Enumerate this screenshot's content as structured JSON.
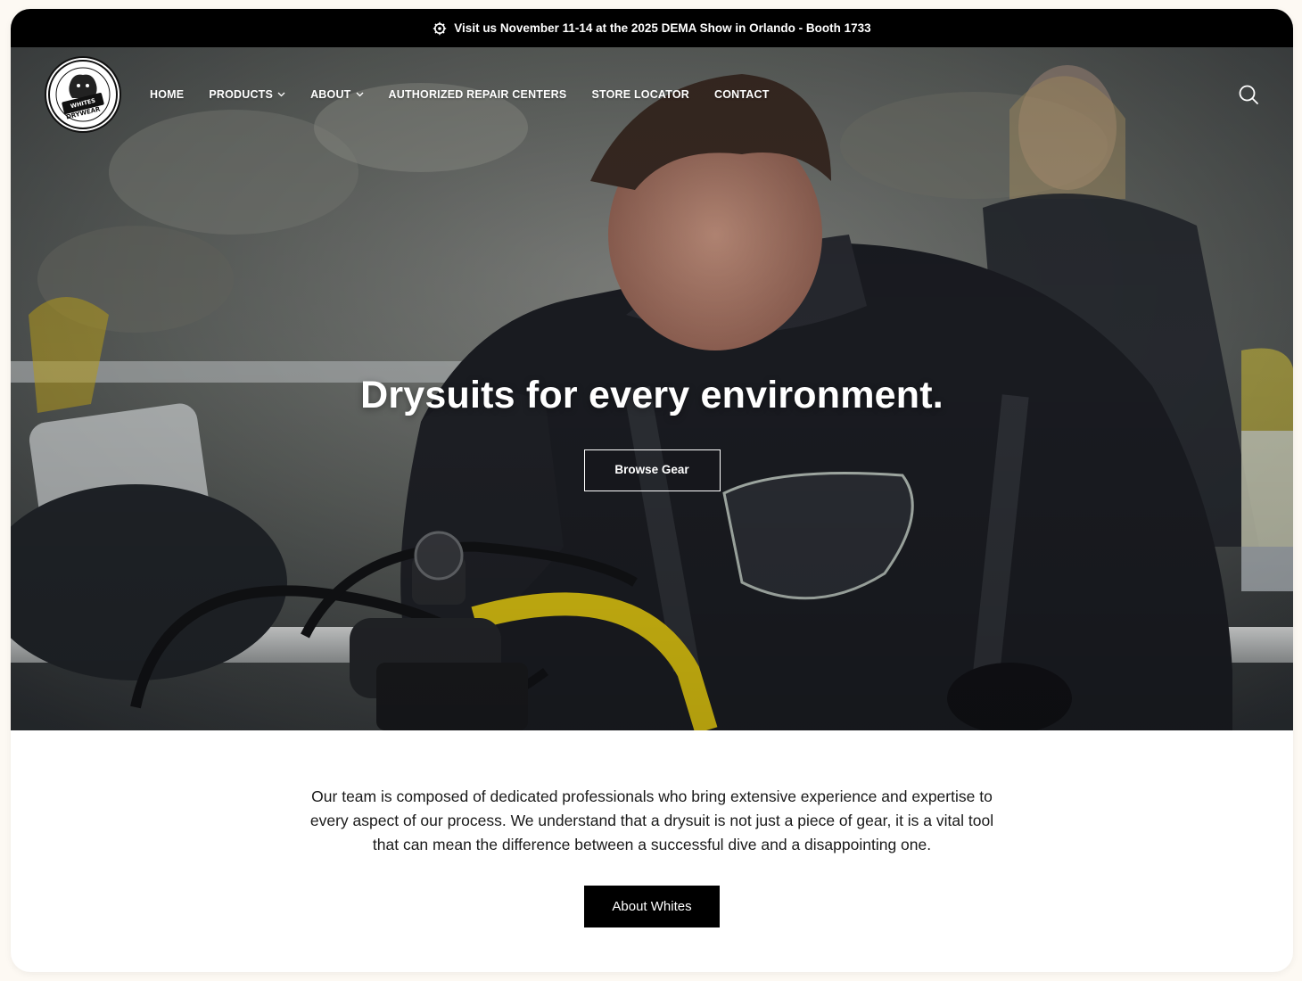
{
  "announcement": {
    "icon": "wheel-icon",
    "text": "Visit us November 11-14 at the 2025 DEMA Show in Orlando - Booth 1733"
  },
  "header": {
    "logo_alt": "Whites Drywear",
    "logo_text_top": "WHITES",
    "logo_text_bottom": "DRYWEAR",
    "nav": [
      {
        "label": "HOME",
        "dropdown": false
      },
      {
        "label": "PRODUCTS",
        "dropdown": true
      },
      {
        "label": "ABOUT",
        "dropdown": true
      },
      {
        "label": "AUTHORIZED REPAIR CENTERS",
        "dropdown": false
      },
      {
        "label": "STORE LOCATOR",
        "dropdown": false
      },
      {
        "label": "CONTACT",
        "dropdown": false
      }
    ],
    "search_icon": "search-icon"
  },
  "hero": {
    "title": "Drysuits for every environment.",
    "button_label": "Browse Gear"
  },
  "about": {
    "text": "Our team is composed of dedicated professionals who bring extensive experience and expertise to every aspect of our process. We understand that a drysuit is not just a piece of gear, it is a vital tool that can mean the difference between a successful dive and a disappointing one.",
    "button_label": "About Whites"
  },
  "colors": {
    "background": "#fdf9f3",
    "bar": "#000000",
    "accent_yellow": "#f2d20a"
  }
}
